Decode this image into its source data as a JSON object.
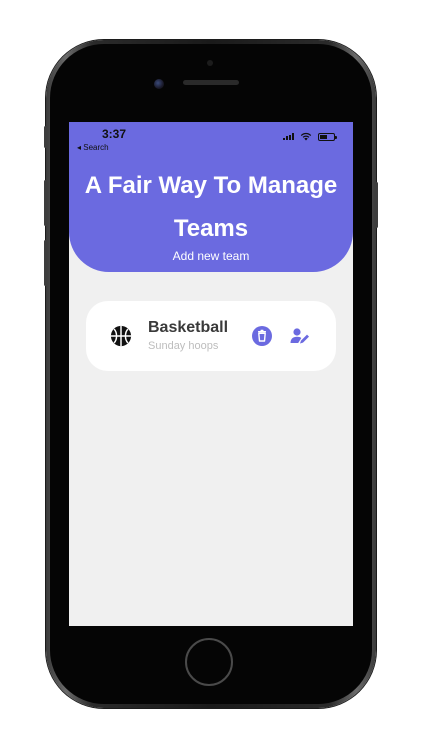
{
  "status_bar": {
    "time": "3:37",
    "back_label": "◂ Search",
    "icons": [
      "signal-icon",
      "wifi-icon",
      "battery-icon"
    ]
  },
  "header": {
    "title": "A Fair Way To Manage Teams",
    "add_team_label": "Add new team"
  },
  "teams": [
    {
      "name": "Basketball",
      "description": "Sunday hoops",
      "icon": "basketball-icon",
      "actions": [
        "delete-icon",
        "edit-user-icon"
      ]
    }
  ],
  "colors": {
    "accent": "#6b6ae0",
    "background": "#f0f0f0",
    "card": "#ffffff"
  }
}
